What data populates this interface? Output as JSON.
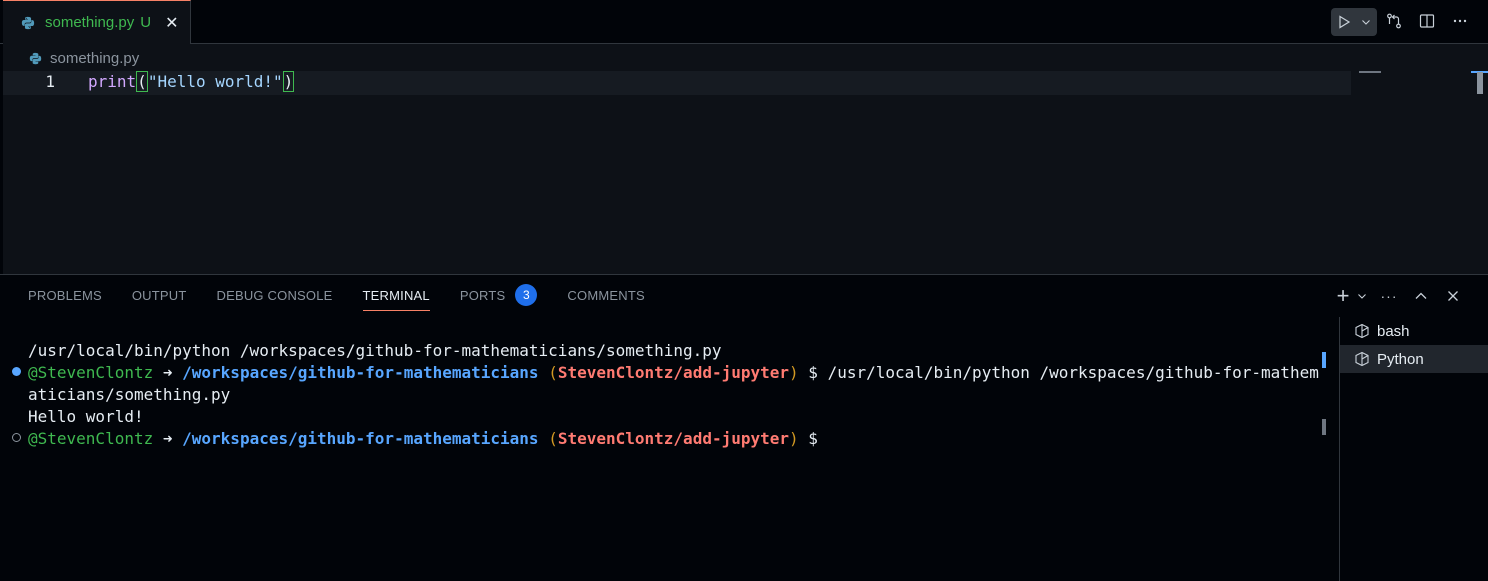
{
  "editor_tab": {
    "filename": "something.py",
    "status": "U",
    "close_glyph": "✕"
  },
  "breadcrumb": {
    "filename": "something.py"
  },
  "editor": {
    "line_number": "1",
    "code": {
      "fn": "print",
      "open": "(",
      "string": "\"Hello world!\"",
      "close": ")"
    }
  },
  "toolbar": {
    "run_icon": "play-icon",
    "run_dropdown_icon": "chevron-down-icon",
    "compare_icon": "git-compare-icon",
    "split_icon": "split-editor-icon",
    "more_icon": "ellipsis-icon"
  },
  "panel": {
    "tabs": [
      {
        "label": "PROBLEMS"
      },
      {
        "label": "OUTPUT"
      },
      {
        "label": "DEBUG CONSOLE"
      },
      {
        "label": "TERMINAL",
        "active": true
      },
      {
        "label": "PORTS",
        "badge": "3"
      },
      {
        "label": "COMMENTS"
      }
    ],
    "actions": {
      "add": "+",
      "more": "···"
    }
  },
  "terminal": {
    "line1": "/usr/local/bin/python /workspaces/github-for-mathematicians/something.py",
    "prompt1": {
      "user": "@StevenClontz",
      "arrow": " ➜ ",
      "path": "/workspaces/github-for-mathematicians",
      "paren_open": " (",
      "branch": "StevenClontz/add-jupyter",
      "paren_close": ")",
      "dollar": " $ ",
      "command": "/usr/local/bin/python /workspaces/github-for-mathem"
    },
    "line3": "aticians/something.py",
    "line4": "Hello world!",
    "prompt2": {
      "user": "@StevenClontz",
      "arrow": " ➜ ",
      "path": "/workspaces/github-for-mathematicians",
      "paren_open": " (",
      "branch": "StevenClontz/add-jupyter",
      "paren_close": ")",
      "dollar": " $"
    }
  },
  "terminal_list": [
    {
      "label": "bash",
      "selected": false
    },
    {
      "label": "Python",
      "selected": true
    }
  ],
  "colors": {
    "accent_tab": "#f78166",
    "modified_green": "#3fb950",
    "path_blue": "#58a6ff",
    "branch_red": "#ff7b72",
    "badge_blue": "#1f6feb"
  }
}
